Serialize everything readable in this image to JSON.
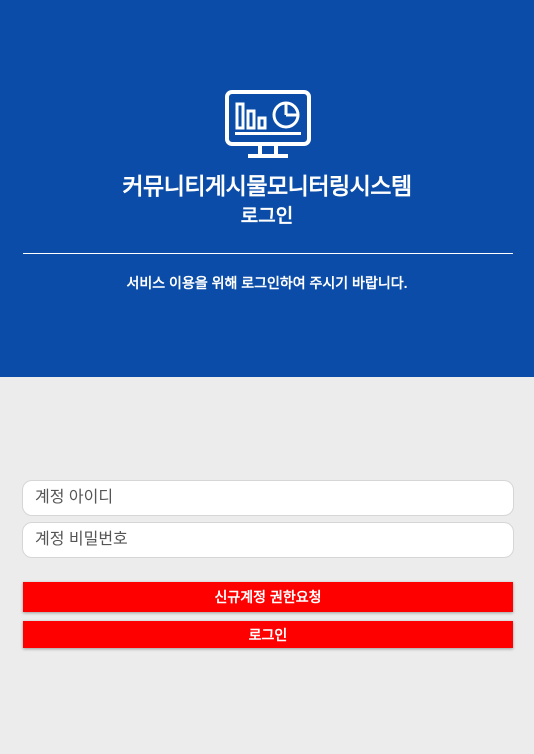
{
  "colors": {
    "header_bg": "#0a4ca7",
    "page_bg": "#ececec",
    "button_bg": "#ff0000",
    "text_light": "#ffffff"
  },
  "header": {
    "logo_icon": "monitor-chart-icon",
    "title": "커뮤니티게시물모니터링시스템",
    "subtitle": "로그인",
    "message": "서비스 이용을 위해 로그인하여 주시기 바랍니다."
  },
  "form": {
    "account_id_placeholder": "계정 아이디",
    "password_placeholder": "계정 비밀번호",
    "request_button_label": "신규계정 권한요청",
    "login_button_label": "로그인"
  }
}
